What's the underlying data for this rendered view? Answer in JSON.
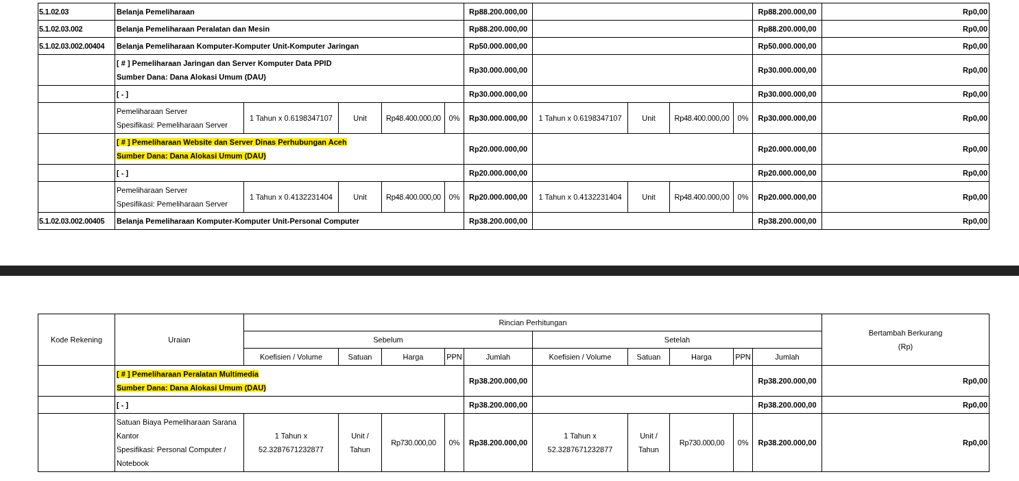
{
  "top_table": {
    "rows": [
      {
        "kind": "account",
        "code": "5.1.02.03",
        "title": "Belanja Pemeliharaan",
        "before_total": "Rp88.200.000,00",
        "after_total": "Rp88.200.000,00",
        "difference": "Rp0,00"
      },
      {
        "kind": "account",
        "code": "5.1.02.03.002",
        "title": "Belanja Pemeliharaan Peralatan dan Mesin",
        "before_total": "Rp88.200.000,00",
        "after_total": "Rp88.200.000,00",
        "difference": "Rp0,00"
      },
      {
        "kind": "account",
        "code": "5.1.02.03.002.00404",
        "title": "Belanja Pemeliharaan Komputer-Komputer Unit-Komputer Jaringan",
        "before_total": "Rp50.000.000,00",
        "after_total": "Rp50.000.000,00",
        "difference": "Rp0,00"
      },
      {
        "kind": "group",
        "title": "[ # ] Pemeliharaan Jaringan dan Server Komputer Data PPID",
        "source": "Sumber Dana: Dana Alokasi Umum (DAU)",
        "highlighted": false,
        "before_total": "Rp30.000.000,00",
        "after_total": "Rp30.000.000,00",
        "difference": "Rp0,00"
      },
      {
        "kind": "subgroup",
        "title": "[ - ]",
        "before_total": "Rp30.000.000,00",
        "after_total": "Rp30.000.000,00",
        "difference": "Rp0,00"
      },
      {
        "kind": "item",
        "name": "Pemeliharaan Server",
        "spec": "Spesifikasi: Pemeliharaan Server",
        "before": {
          "coefficient": "1 Tahun x 0.6198347107",
          "unit": "Unit",
          "price": "Rp48.400.000,00",
          "tax": "0%",
          "total": "Rp30.000.000,00"
        },
        "after": {
          "coefficient": "1 Tahun x 0.6198347107",
          "unit": "Unit",
          "price": "Rp48.400.000,00",
          "tax": "0%",
          "total": "Rp30.000.000,00"
        },
        "difference": "Rp0,00"
      },
      {
        "kind": "group",
        "title": "[ # ] Pemeliharaan Website dan Server Dinas Perhubungan Aceh",
        "source": "Sumber Dana: Dana Alokasi Umum (DAU)",
        "highlighted": true,
        "before_total": "Rp20.000.000,00",
        "after_total": "Rp20.000.000,00",
        "difference": "Rp0,00"
      },
      {
        "kind": "subgroup",
        "title": "[ - ]",
        "before_total": "Rp20.000.000,00",
        "after_total": "Rp20.000.000,00",
        "difference": "Rp0,00"
      },
      {
        "kind": "item",
        "name": "Pemeliharaan Server",
        "spec": "Spesifikasi: Pemeliharaan Server",
        "before": {
          "coefficient": "1 Tahun x 0.4132231404",
          "unit": "Unit",
          "price": "Rp48.400.000,00",
          "tax": "0%",
          "total": "Rp20.000.000,00"
        },
        "after": {
          "coefficient": "1 Tahun x 0.4132231404",
          "unit": "Unit",
          "price": "Rp48.400.000,00",
          "tax": "0%",
          "total": "Rp20.000.000,00"
        },
        "difference": "Rp0,00"
      },
      {
        "kind": "account",
        "code": "5.1.02.03.002.00405",
        "title": "Belanja Pemeliharaan Komputer-Komputer Unit-Personal Computer",
        "before_total": "Rp38.200.000,00",
        "after_total": "Rp38.200.000,00",
        "difference": "Rp0,00"
      }
    ]
  },
  "bottom_table": {
    "header": {
      "code": "Kode Rekening",
      "description": "Uraian",
      "calculation": "Rincian Perhitungan",
      "before": "Sebelum",
      "after": "Setelah",
      "before_columns": [
        "Koefisien / Volume",
        "Satuan",
        "Harga",
        "PPN",
        "Jumlah"
      ],
      "after_columns": [
        "Koefisien / Volume",
        "Satuan",
        "Harga",
        "PPN",
        "Jumlah"
      ],
      "difference": "Bertambah Berkurang",
      "difference_unit": "(Rp)"
    },
    "rows": [
      {
        "kind": "group",
        "title": "[ # ] Pemeliharaan Peralatan Multimedia",
        "source": "Sumber Dana: Dana Alokasi Umum (DAU)",
        "highlighted": true,
        "before_total": "Rp38.200.000,00",
        "after_total": "Rp38.200.000,00",
        "difference": "Rp0,00"
      },
      {
        "kind": "subgroup",
        "title": "[ - ]",
        "before_total": "Rp38.200.000,00",
        "after_total": "Rp38.200.000,00",
        "difference": "Rp0,00"
      },
      {
        "kind": "item",
        "name": "Satuan Biaya Pemeliharaan Sarana Kantor",
        "spec": "Spesifikasi: Personal Computer / Notebook",
        "before": {
          "coefficient": "1 Tahun x 52.3287671232877",
          "unit": "Unit / Tahun",
          "price": "Rp730.000,00",
          "tax": "0%",
          "total": "Rp38.200.000,00"
        },
        "after": {
          "coefficient": "1 Tahun x 52.3287671232877",
          "unit": "Unit / Tahun",
          "price": "Rp730.000,00",
          "tax": "0%",
          "total": "Rp38.200.000,00"
        },
        "difference": "Rp0,00"
      }
    ]
  }
}
